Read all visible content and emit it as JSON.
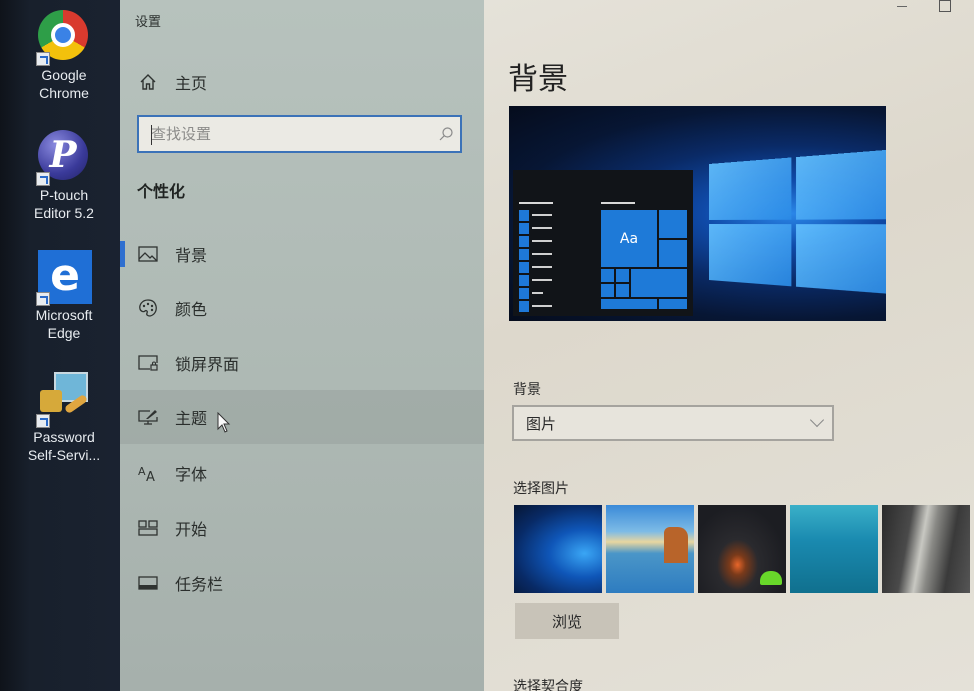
{
  "desktop": {
    "icons": [
      {
        "label_line1": "Google",
        "label_line2": "Chrome",
        "icon": "chrome-icon"
      },
      {
        "label_line1": "P-touch",
        "label_line2": "Editor 5.2",
        "icon": "ptouch-editor-icon",
        "glyph": "P"
      },
      {
        "label_line1": "Microsoft",
        "label_line2": "Edge",
        "icon": "edge-icon",
        "glyph": "e"
      },
      {
        "label_line1": "Password",
        "label_line2": "Self-Servi...",
        "icon": "password-self-service-icon"
      }
    ]
  },
  "window": {
    "title": "设置",
    "accent_color": "#2f6fd0"
  },
  "nav": {
    "home_label": "主页",
    "search_placeholder": "查找设置",
    "search_value": "",
    "section_title": "个性化",
    "items": [
      {
        "label": "背景",
        "icon": "picture-icon",
        "active": true
      },
      {
        "label": "颜色",
        "icon": "palette-icon",
        "active": false
      },
      {
        "label": "锁屏界面",
        "icon": "lock-screen-icon",
        "active": false
      },
      {
        "label": "主题",
        "icon": "theme-brush-icon",
        "active": false,
        "hovered": true
      },
      {
        "label": "字体",
        "icon": "font-icon",
        "active": false
      },
      {
        "label": "开始",
        "icon": "start-icon",
        "active": false
      },
      {
        "label": "任务栏",
        "icon": "taskbar-icon",
        "active": false
      }
    ]
  },
  "content": {
    "page_title": "背景",
    "preview_tile_text": "Aa",
    "background_label": "背景",
    "background_selected": "图片",
    "choose_picture_label": "选择图片",
    "pictures": [
      {
        "name": "windows-10-hero"
      },
      {
        "name": "beach-rocks"
      },
      {
        "name": "night-sky-tent"
      },
      {
        "name": "underwater-swimmer"
      },
      {
        "name": "rock-cliff"
      }
    ],
    "browse_label": "浏览",
    "choose_fit_label": "选择契合度"
  }
}
